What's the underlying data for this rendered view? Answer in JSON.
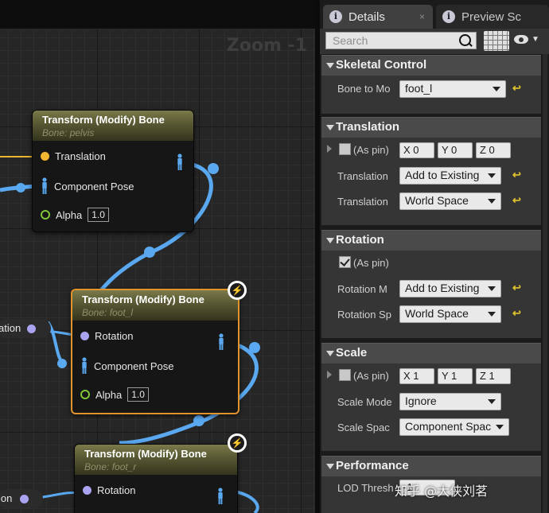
{
  "graph": {
    "zoom_label": "Zoom -1",
    "nodes": [
      {
        "title": "Transform (Modify) Bone",
        "subtitle": "Bone: pelvis",
        "pin1": "Translation",
        "pin2": "Component Pose",
        "alpha_label": "Alpha",
        "alpha_value": "1.0"
      },
      {
        "title": "Transform (Modify) Bone",
        "subtitle": "Bone: foot_l",
        "pin1": "Rotation",
        "pin2": "Component Pose",
        "alpha_label": "Alpha",
        "alpha_value": "1.0"
      },
      {
        "title": "Transform (Modify) Bone",
        "subtitle": "Bone: foot_r",
        "pin1": "Rotation"
      }
    ],
    "left_pill_1": "ation",
    "left_pill_2": "ion"
  },
  "tabs": [
    {
      "label": "Details",
      "close": "×"
    },
    {
      "label": "Preview Sc"
    }
  ],
  "search": {
    "placeholder": "Search"
  },
  "sections": {
    "skeletal": {
      "title": "Skeletal Control",
      "bone_label": "Bone to Mo",
      "bone_value": "foot_l"
    },
    "translation": {
      "title": "Translation",
      "as_pin": "(As pin)",
      "x": "X  0",
      "y": "Y  0",
      "z": "Z  0",
      "mode_label": "Translation",
      "mode_value": "Add to Existing",
      "space_label": "Translation",
      "space_value": "World Space"
    },
    "rotation": {
      "title": "Rotation",
      "as_pin": "(As pin)",
      "mode_label": "Rotation M",
      "mode_value": "Add to Existing",
      "space_label": "Rotation Sp",
      "space_value": "World Space"
    },
    "scale": {
      "title": "Scale",
      "as_pin": "(As pin)",
      "x": "X  1",
      "y": "Y  1",
      "z": "Z  1",
      "mode_label": "Scale Mode",
      "mode_value": "Ignore",
      "space_label": "Scale Spac",
      "space_value": "Component Spac"
    },
    "performance": {
      "title": "Performance",
      "lod_label": "LOD Thresh",
      "lod_value": "-1"
    }
  },
  "reset_glyph": "↩",
  "watermark": "知乎 @大侠刘茗",
  "colors": {
    "selected_border": "#e2942c",
    "pose_wire": "#5aa8f0",
    "vector_pin": "#f2b632",
    "float_pin": "#7fc63a",
    "rotator_pin": "#a9a3f0"
  }
}
